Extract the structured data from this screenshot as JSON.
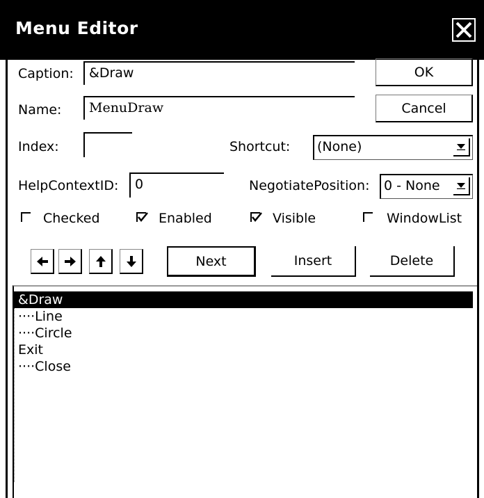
{
  "window": {
    "title": "Menu Editor"
  },
  "buttons": {
    "ok": "OK",
    "cancel": "Cancel",
    "next": "Next",
    "insert": "Insert",
    "delete": "Delete"
  },
  "fields": {
    "caption_label": "Caption:",
    "caption_value": "&Draw",
    "name_label": "Name:",
    "name_value": "MenuDraw",
    "index_label": "Index:",
    "index_value": "",
    "shortcut_label": "Shortcut:",
    "shortcut_value": "(None)",
    "helpcontext_label": "HelpContextID:",
    "helpcontext_value": "0",
    "negotiate_label": "NegotiatePosition:",
    "negotiate_value": "0 - None"
  },
  "checkboxes": [
    {
      "label": "Checked",
      "checked": false
    },
    {
      "label": "Enabled",
      "checked": true
    },
    {
      "label": "Visible",
      "checked": true
    },
    {
      "label": "WindowList",
      "checked": false
    }
  ],
  "arrow_buttons": [
    "left-arrow-icon",
    "right-arrow-icon",
    "up-arrow-icon",
    "down-arrow-icon"
  ],
  "menu_list": [
    {
      "text": "&Draw",
      "selected": true
    },
    {
      "text": "····Line",
      "selected": false
    },
    {
      "text": "····Circle",
      "selected": false
    },
    {
      "text": "Exit",
      "selected": false
    },
    {
      "text": "····Close",
      "selected": false
    }
  ]
}
